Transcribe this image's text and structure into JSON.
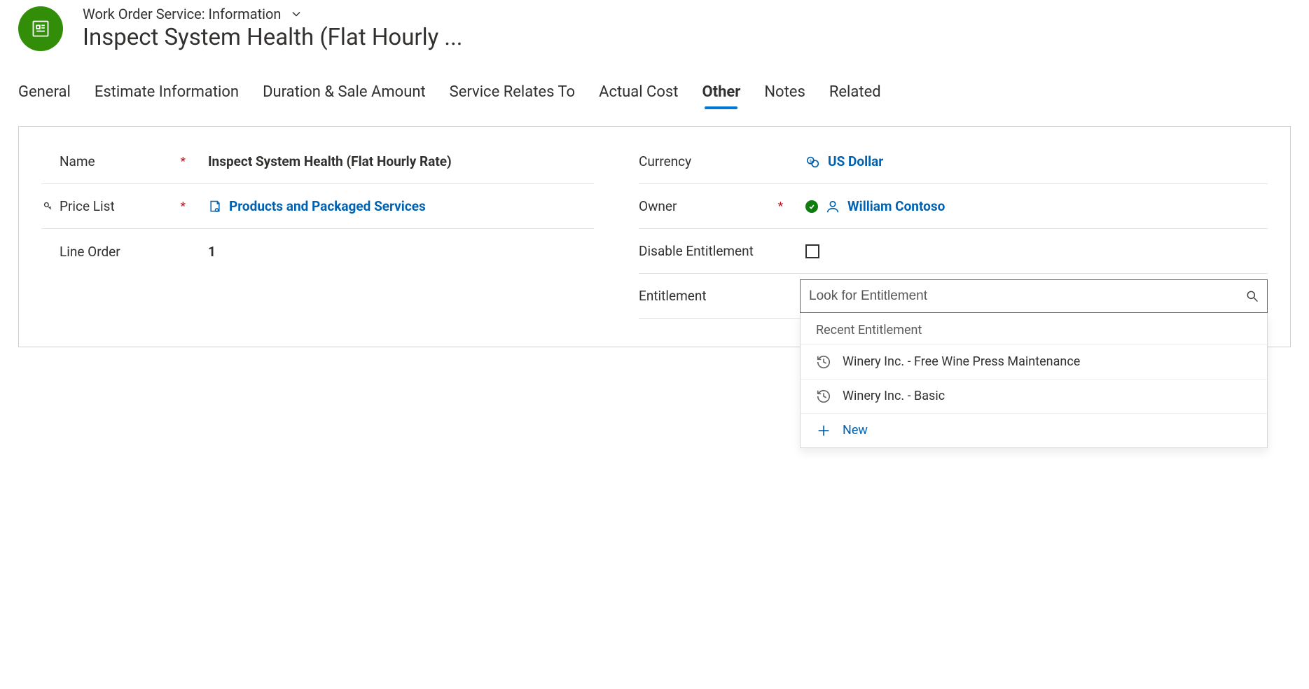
{
  "header": {
    "breadcrumb": "Work Order Service: Information",
    "title": "Inspect System Health (Flat Hourly ..."
  },
  "tabs": {
    "items": [
      {
        "label": "General"
      },
      {
        "label": "Estimate Information"
      },
      {
        "label": "Duration & Sale Amount"
      },
      {
        "label": "Service Relates To"
      },
      {
        "label": "Actual Cost"
      },
      {
        "label": "Other"
      },
      {
        "label": "Notes"
      },
      {
        "label": "Related"
      }
    ],
    "selected_index": 5
  },
  "form": {
    "left": {
      "name": {
        "label": "Name",
        "required": true,
        "value": "Inspect System Health (Flat Hourly Rate)"
      },
      "price_list": {
        "label": "Price List",
        "required": true,
        "value": "Products and Packaged Services"
      },
      "line_order": {
        "label": "Line Order",
        "required": false,
        "value": "1"
      }
    },
    "right": {
      "currency": {
        "label": "Currency",
        "value": "US Dollar"
      },
      "owner": {
        "label": "Owner",
        "required": true,
        "value": "William Contoso"
      },
      "disable_entitlement": {
        "label": "Disable Entitlement",
        "checked": false
      },
      "entitlement": {
        "label": "Entitlement",
        "placeholder": "Look for Entitlement",
        "flyout_header": "Recent Entitlement",
        "options": [
          "Winery Inc. - Free Wine Press Maintenance",
          "Winery Inc. - Basic"
        ],
        "new_label": "New"
      }
    }
  }
}
